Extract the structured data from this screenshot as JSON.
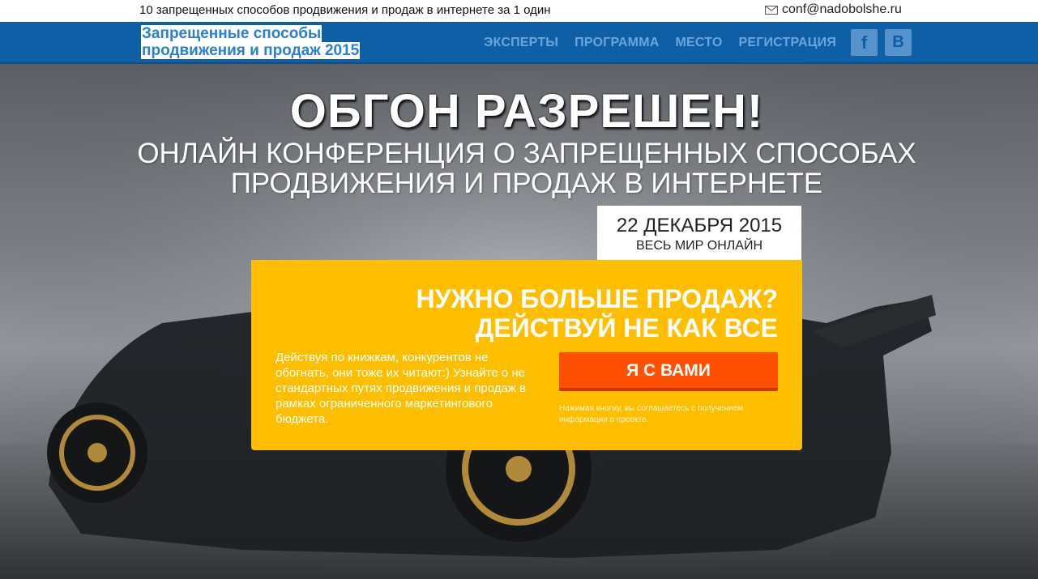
{
  "topbar": {
    "tagline": "10 запрещенных способов продвижения и продаж в интернете за 1 один",
    "email": "conf@nadobolshe.ru",
    "email_icon": "mail-icon"
  },
  "navbar": {
    "brand_line1": "Запрещенные способы",
    "brand_line2": "продвижения и продаж 2015",
    "links": [
      "ЭКСПЕРТЫ",
      "ПРОГРАММА",
      "МЕСТО",
      "РЕГИСТРАЦИЯ"
    ],
    "social": {
      "facebook": "f",
      "vk": "B"
    }
  },
  "hero": {
    "headline": "ОБГОН РАЗРЕШЕН!",
    "sub_line1": "ОНЛАЙН КОНФЕРЕНЦИЯ О ЗАПРЕЩЕННЫХ СПОСОБАХ",
    "sub_line2": "ПРОДВИЖЕНИЯ И ПРОДАЖ В ИНТЕРНЕТЕ",
    "date": "22 ДЕКАБРЯ 2015",
    "where": "ВЕСЬ МИР ОНЛАЙН",
    "background_image": "black sports car drifting with smoke"
  },
  "cta": {
    "title_line1": "НУЖНО БОЛЬШЕ ПРОДАЖ?",
    "title_line2": "ДЕЙСТВУЙ НЕ КАК ВСЕ",
    "description": "Действуя по книжкам, конкурентов не обогнать, они тоже их читают:) Узнайте о не стандартных путях продвижения и продаж в рамках ограниченного маркетингового бюджета.",
    "button": "Я С ВАМИ",
    "note": "Нажимая кнопку, вы соглашаетесь с получением информации о проекте."
  },
  "colors": {
    "navbar": "#0e5fa6",
    "nav_link": "#6aa5dc",
    "cta_panel": "#ffbf00",
    "cta_button": "#ff4f00"
  }
}
